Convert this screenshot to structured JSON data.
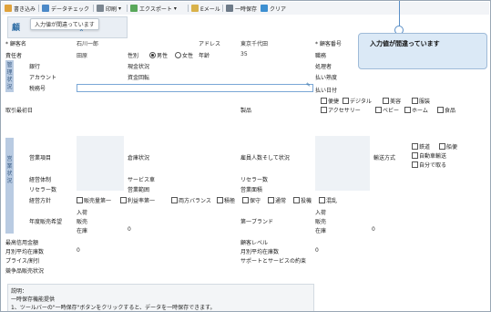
{
  "toolbar": {
    "write": "書き込み",
    "datacheck": "データチェック",
    "print": "印刷",
    "export": "エクスポート",
    "email": "Eメール",
    "tempsave": "一時保存",
    "clear": "クリア"
  },
  "header": {
    "title": "顧",
    "tooltip": "入力値が間違っています"
  },
  "callout": {
    "text": "入力値が間違っています"
  },
  "form": {
    "name_label": "* 顧客名",
    "name_value": "石川一郎",
    "address_label": "アドレス",
    "address_value": "東京千代田",
    "custno_label": "* 顧客番号",
    "manager_label": "責任者",
    "manager_value": "田原",
    "gender_label": "性別",
    "male": "男性",
    "female": "女性",
    "age_label": "年齢",
    "age_value": "35",
    "job_label": "職務",
    "bar1_text": "管理状況",
    "bank_label": "銀行",
    "cash_label": "現金状況",
    "handler_label": "処理者",
    "account_label": "アカウント",
    "fund_label": "資金回転",
    "pay_label": "払い熟度",
    "taxno_label": "税務号",
    "paydate_label": "払い日付",
    "tags_row1": [
      "便捷",
      "デジタル",
      "美容",
      "服装"
    ],
    "tags_row2": [
      "アクセサリー",
      "ベビー",
      "ホーム",
      "食品"
    ],
    "firstdate_label": "取引最初日",
    "product_label": "製品",
    "bar2_text": "営業状況",
    "bizitem_label": "営業項目",
    "warehouse_label": "倉庫状況",
    "employees_label": "雇員人数そして状況",
    "ship_label": "輸送方式",
    "ship_opts": [
      "鉄道",
      "船便",
      "自動車輸送",
      "自分で取る"
    ],
    "bizsys_label": "経営体制",
    "service_label": "サービス車",
    "reseller_label": "リセラー数",
    "reseller2_label": "リセラー数",
    "bizscope_label": "営業範囲",
    "bizarea_label": "営業面積",
    "policy_label": "経営方針",
    "policy_opts": [
      "販売量第一",
      "利益率第一",
      "両方バランス",
      "積極",
      "保守",
      "通常",
      "投機",
      "混乱"
    ],
    "stock_label": "入荷",
    "annual_label": "年度販売希望",
    "sales_label": "販売",
    "stock2_label": "入荷",
    "firstbrand_label": "第一ブランド",
    "sales2_label": "販売",
    "inv_label": "在庫",
    "inv_value": "0",
    "inv2_label": "在庫",
    "inv2_value": "0",
    "credit_label": "最高信用金額",
    "level_label": "顧客レベル",
    "avg_label": "月別平均在庫数",
    "avg_value": "0",
    "avg2_label": "月別平均在庫数",
    "avg2_value": "0",
    "price_label": "プライス/割引",
    "support_label": "サポートとサービスの約束",
    "compete_label": "競争品販売状況"
  },
  "notes": {
    "title": "説明：",
    "line1": "一時保存機能提供",
    "line2": "1、ツールバーの\"一時保存\"ボタンをクリックすると、データを一時保存できます。"
  },
  "colors": {
    "accent": "#2e6da4",
    "side_bar": "#b9cbe2",
    "callout_bg": "#dbe9f6"
  }
}
